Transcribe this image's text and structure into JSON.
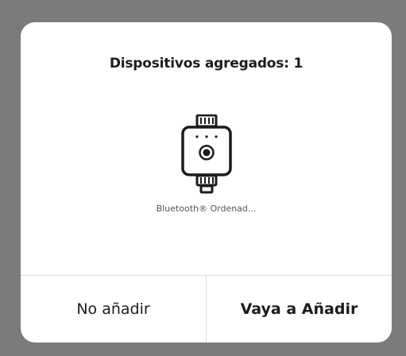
{
  "dialog": {
    "title": "Dispositivos agregados: 1",
    "device": {
      "icon": "water-timer-device-icon",
      "name": "Bluetooth® Ordenad..."
    },
    "buttons": {
      "cancel_label": "No añadir",
      "confirm_label": "Vaya a Añadir"
    }
  },
  "colors": {
    "overlay": "#7b7b7b",
    "dialog_background": "#ffffff",
    "text": "#1c1c1c",
    "secondary_text": "#555555",
    "divider": "#dcdcdc"
  }
}
